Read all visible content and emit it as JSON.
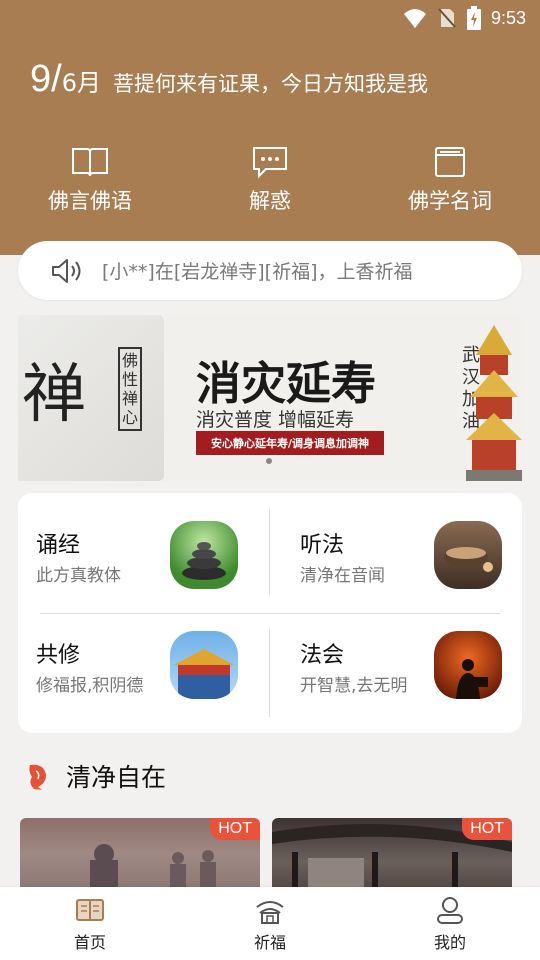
{
  "status_bar": {
    "time": "9:53",
    "icons": [
      "wifi-icon",
      "no-sim-icon",
      "battery-charging-icon"
    ]
  },
  "header": {
    "day": "9",
    "separator": "/",
    "month": "6月",
    "motto": "菩提何来有证果，今日方知我是我",
    "background_color": "#a87d52",
    "nav": [
      {
        "label": "佛言佛语",
        "icon": "book-icon"
      },
      {
        "label": "解惑",
        "icon": "chat-bubble-icon"
      },
      {
        "label": "佛学名词",
        "icon": "folder-icon"
      }
    ]
  },
  "announcement": {
    "icon": "speaker-icon",
    "text": "[小**]在[岩龙禅寺][祈福]，上香祈福"
  },
  "banner": {
    "big_char": "禅",
    "vertical_text": "佛性禅心",
    "title": "消灾延寿",
    "subtitle": "消灾普度 增幅延寿",
    "red_label": "安心静心延年寿/调身调息加调神",
    "calligraphy": "武汉加油",
    "active_page": 1,
    "accent_color": "#a21e1e"
  },
  "features": [
    {
      "title": "诵经",
      "subtitle": "此方真教体",
      "thumb": "stones-thumbnail"
    },
    {
      "title": "听法",
      "subtitle": "清净在音闻",
      "thumb": "tea-bowl-thumbnail"
    },
    {
      "title": "共修",
      "subtitle": "修福报,积阴德",
      "thumb": "temple-roof-thumbnail"
    },
    {
      "title": "法会",
      "subtitle": "开智慧,去无明",
      "thumb": "reading-sunset-thumbnail"
    }
  ],
  "section": {
    "title": "清净自在",
    "icon": "carp-icon"
  },
  "featured": [
    {
      "badge": "HOT",
      "thumb": "temple-statues-thumbnail"
    },
    {
      "badge": "HOT",
      "thumb": "temple-hall-thumbnail"
    }
  ],
  "tabbar": [
    {
      "label": "首页",
      "icon": "home-book-icon",
      "active": true
    },
    {
      "label": "祈福",
      "icon": "temple-icon",
      "active": false
    },
    {
      "label": "我的",
      "icon": "user-icon",
      "active": false
    }
  ],
  "colors": {
    "brand": "#a87d52",
    "hot": "#e9533c"
  }
}
